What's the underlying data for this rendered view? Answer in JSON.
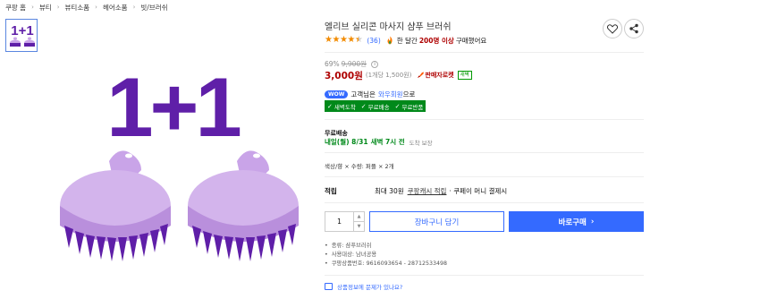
{
  "breadcrumb": [
    "쿠팡 홈",
    "뷰티",
    "뷰티소품",
    "헤어소품",
    "빗/브러쉬"
  ],
  "thumbnail": {
    "label": "1+1"
  },
  "main_image": {
    "label": "1+1"
  },
  "product": {
    "title": "엘리브 실리콘 마사지 샴푸 브러쉬",
    "rating_value": 4.5,
    "review_count": "(36)",
    "buy_prefix": "한 달간",
    "buy_count": "200명 이상",
    "buy_suffix": "구매했어요"
  },
  "pricing": {
    "discount": "69%",
    "original_price": "9,900원",
    "price": "3,000원",
    "unit_price": "(1개당 1,500원)",
    "rocket_label": "판매자로켓",
    "fresh_label": "새벽"
  },
  "wow": {
    "badge": "WOW",
    "text_prefix": "고객님은",
    "link": "와우회원",
    "text_suffix": "으로",
    "benefits": [
      "새벽도착",
      "무료배송",
      "무료반품"
    ]
  },
  "shipping": {
    "label": "무료배송",
    "arrival_day": "내일(월) 8/31",
    "arrival_time": "새벽 7시 전",
    "arrival_guarantee": "도착 보장"
  },
  "option": {
    "text": "색상/향 × 수량: 퍼플 × 2개"
  },
  "points": {
    "label": "적립",
    "prefix": "최대 30원",
    "link": "쿠팡캐시 적립",
    "suffix": "· 쿠페이 머니 결제시"
  },
  "purchase": {
    "quantity": "1",
    "cart_label": "장바구니 담기",
    "buy_label": "바로구매"
  },
  "specs": [
    "종류: 샴푸브러쉬",
    "사용대상: 남녀공용",
    "쿠팡상품번호: 9616093654 - 28712533498"
  ],
  "question_link": "상품정보에 문제가 있나요?",
  "colors": {
    "accent_blue": "#346aff",
    "price_red": "#ae0000",
    "wow_green": "#00891a",
    "star_orange": "#f28b00",
    "product_purple": "#5f1fa8",
    "brush_lilac": "#c9a4e8"
  },
  "icons": {
    "wishlist": "heart-icon",
    "share": "share-icon",
    "popular": "fire-icon",
    "rocket": "rocket-icon",
    "buy_arrow": "chevron-right-icon",
    "question": "chat-icon"
  }
}
